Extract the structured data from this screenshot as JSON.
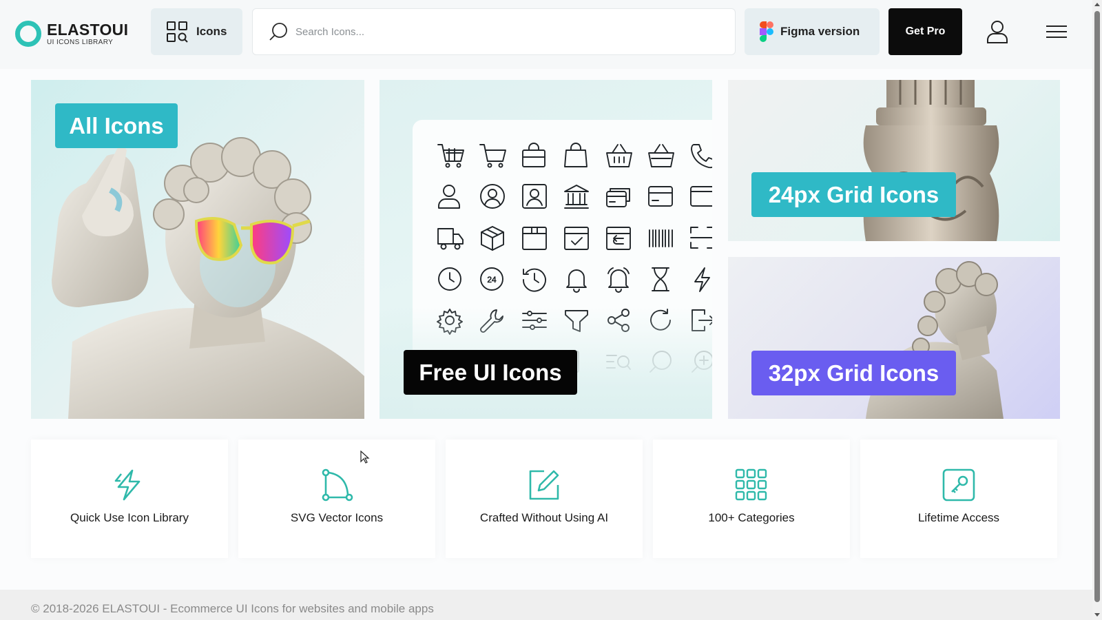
{
  "brand": {
    "name": "ELASTOUI",
    "tagline": "UI ICONS LIBRARY",
    "accent_color": "#2dc2b6"
  },
  "header": {
    "icons_label": "Icons",
    "search_placeholder": "Search Icons...",
    "figma_label": "Figma version",
    "pro_label": "Get Pro"
  },
  "banners": {
    "all": "All Icons",
    "free": "Free UI Icons",
    "grid24": "24px Grid Icons",
    "grid32": "32px Grid Icons"
  },
  "icon_showcase": [
    [
      "cart-icon",
      "cart-outline-icon",
      "bag-icon",
      "shopping-bag-icon",
      "basket-icon",
      "basket-alt-icon",
      "phone-icon"
    ],
    [
      "user-icon",
      "user-circle-icon",
      "user-square-icon",
      "bank-icon",
      "cards-icon",
      "card-icon",
      "wallet-icon"
    ],
    [
      "truck-icon",
      "box-3d-icon",
      "package-icon",
      "package-check-icon",
      "package-return-icon",
      "barcode-icon",
      "scan-icon"
    ],
    [
      "clock-icon",
      "24h-icon",
      "history-icon",
      "bell-icon",
      "bell-ring-icon",
      "hourglass-icon",
      "flash-icon"
    ],
    [
      "settings-icon",
      "wrench-icon",
      "sliders-icon",
      "funnel-icon",
      "share-icon",
      "refresh-icon",
      "exit-icon"
    ]
  ],
  "features": [
    {
      "label": "Quick Use Icon Library",
      "icon": "lightning-icon"
    },
    {
      "label": "SVG Vector Icons",
      "icon": "vector-curve-icon"
    },
    {
      "label": "Crafted Without Using AI",
      "icon": "pencil-edit-icon"
    },
    {
      "label": "100+ Categories",
      "icon": "grid-dots-icon"
    },
    {
      "label": "Lifetime Access",
      "icon": "key-icon"
    }
  ],
  "footer": {
    "copyright": "© 2018-2026 ELASTOUI - Ecommerce UI Icons for websites and mobile apps"
  },
  "colors": {
    "teal_tag": "#2fb9c6",
    "purple_tag": "#6a5df0",
    "black_tag": "#050505",
    "feature_icon": "#2fb9aa"
  }
}
